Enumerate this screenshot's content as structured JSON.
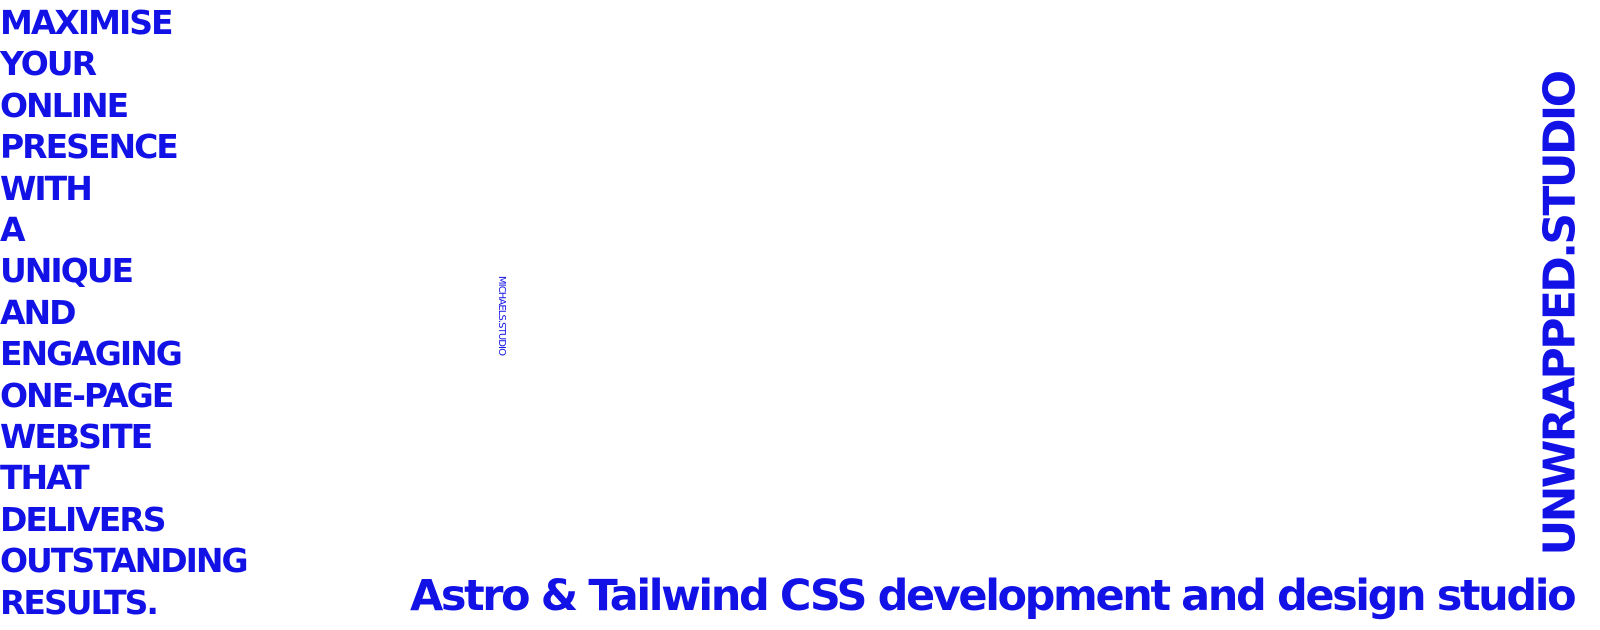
{
  "headline": {
    "lines": [
      "MAXIMISE",
      "YOUR",
      "ONLINE",
      "PRESENCE",
      "WITH",
      "A",
      "UNIQUE",
      "AND",
      "ENGAGING",
      "ONE-PAGE",
      "WEBSITE",
      "THAT",
      "DELIVERS",
      "OUTSTANDING",
      "RESULTS."
    ]
  },
  "side_label": "MICHAELS.STUDIO",
  "brand": "UNWRAPPED.STUDIO",
  "tagline": "Astro & Tailwind CSS  development and design studio",
  "colors": {
    "accent": "#1212e6",
    "background": "#ffffff"
  }
}
